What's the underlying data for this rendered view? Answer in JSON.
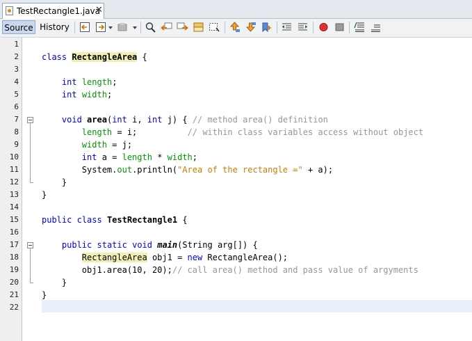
{
  "file_tab": {
    "name": "TestRectangle1.java",
    "close": "✕"
  },
  "editor_tabs": {
    "source": "Source",
    "history": "History"
  },
  "toolbar_icons": [
    "back-icon",
    "forward-icon",
    "last-edit-icon",
    "find-icon",
    "find-previous-icon",
    "find-next-icon",
    "toggle-highlight-icon",
    "find-selection-icon",
    "previous-bookmark-icon",
    "next-bookmark-icon",
    "toggle-bookmark-icon",
    "shift-left-icon",
    "shift-right-icon",
    "start-macro-icon",
    "stop-macro-icon",
    "comment-icon",
    "uncomment-icon"
  ],
  "colors": {
    "keyword": "#0000e6",
    "field": "#009900",
    "string": "#ce7b00",
    "comment": "#969696",
    "highlight": "#f0f0b4",
    "current_line": "#e9eff8"
  },
  "line_numbers": [
    "1",
    "2",
    "3",
    "4",
    "5",
    "6",
    "7",
    "8",
    "9",
    "10",
    "11",
    "12",
    "13",
    "14",
    "15",
    "16",
    "17",
    "18",
    "19",
    "20",
    "21",
    "22"
  ],
  "code": [
    {
      "line": 1,
      "indent": "",
      "tokens": []
    },
    {
      "line": 2,
      "indent": "",
      "tokens": [
        {
          "t": "kw",
          "v": "class"
        },
        {
          "t": "p",
          "v": " "
        },
        {
          "t": "cls-hl",
          "v": "RectangleArea"
        },
        {
          "t": "p",
          "v": " {"
        }
      ]
    },
    {
      "line": 3,
      "indent": "",
      "tokens": []
    },
    {
      "line": 4,
      "indent": "    ",
      "tokens": [
        {
          "t": "kw",
          "v": "int"
        },
        {
          "t": "p",
          "v": " "
        },
        {
          "t": "field",
          "v": "length"
        },
        {
          "t": "p",
          "v": ";"
        }
      ]
    },
    {
      "line": 5,
      "indent": "    ",
      "tokens": [
        {
          "t": "kw",
          "v": "int"
        },
        {
          "t": "p",
          "v": " "
        },
        {
          "t": "field",
          "v": "width"
        },
        {
          "t": "p",
          "v": ";"
        }
      ]
    },
    {
      "line": 6,
      "indent": "",
      "tokens": []
    },
    {
      "line": 7,
      "indent": "    ",
      "tokens": [
        {
          "t": "kw",
          "v": "void"
        },
        {
          "t": "p",
          "v": " "
        },
        {
          "t": "mdef",
          "v": "area"
        },
        {
          "t": "p",
          "v": "("
        },
        {
          "t": "kw",
          "v": "int"
        },
        {
          "t": "p",
          "v": " i, "
        },
        {
          "t": "kw",
          "v": "int"
        },
        {
          "t": "p",
          "v": " j) { "
        },
        {
          "t": "cmt",
          "v": "// method area() definition"
        }
      ]
    },
    {
      "line": 8,
      "indent": "        ",
      "tokens": [
        {
          "t": "field",
          "v": "length"
        },
        {
          "t": "p",
          "v": " = i;          "
        },
        {
          "t": "cmt",
          "v": "// within class variables access without object"
        }
      ]
    },
    {
      "line": 9,
      "indent": "        ",
      "tokens": [
        {
          "t": "field",
          "v": "width"
        },
        {
          "t": "p",
          "v": " = j;"
        }
      ]
    },
    {
      "line": 10,
      "indent": "        ",
      "tokens": [
        {
          "t": "kw",
          "v": "int"
        },
        {
          "t": "p",
          "v": " a = "
        },
        {
          "t": "field",
          "v": "length"
        },
        {
          "t": "p",
          "v": " * "
        },
        {
          "t": "field",
          "v": "width"
        },
        {
          "t": "p",
          "v": ";"
        }
      ]
    },
    {
      "line": 11,
      "indent": "        ",
      "tokens": [
        {
          "t": "p",
          "v": "System."
        },
        {
          "t": "field",
          "v": "out"
        },
        {
          "t": "p",
          "v": ".println("
        },
        {
          "t": "str",
          "v": "\"Area of the rectangle =\""
        },
        {
          "t": "p",
          "v": " + a);"
        }
      ]
    },
    {
      "line": 12,
      "indent": "    ",
      "tokens": [
        {
          "t": "p",
          "v": "}"
        }
      ]
    },
    {
      "line": 13,
      "indent": "",
      "tokens": [
        {
          "t": "p",
          "v": "}"
        }
      ]
    },
    {
      "line": 14,
      "indent": "",
      "tokens": []
    },
    {
      "line": 15,
      "indent": "",
      "tokens": [
        {
          "t": "kw",
          "v": "public"
        },
        {
          "t": "p",
          "v": " "
        },
        {
          "t": "kw",
          "v": "class"
        },
        {
          "t": "p",
          "v": " "
        },
        {
          "t": "cls",
          "v": "TestRectangle1"
        },
        {
          "t": "p",
          "v": " {"
        }
      ]
    },
    {
      "line": 16,
      "indent": "",
      "tokens": []
    },
    {
      "line": 17,
      "indent": "    ",
      "tokens": [
        {
          "t": "kw",
          "v": "public"
        },
        {
          "t": "p",
          "v": " "
        },
        {
          "t": "kw",
          "v": "static"
        },
        {
          "t": "p",
          "v": " "
        },
        {
          "t": "kw",
          "v": "void"
        },
        {
          "t": "p",
          "v": " "
        },
        {
          "t": "static",
          "v": "main"
        },
        {
          "t": "p",
          "v": "(String arg[]) {"
        }
      ]
    },
    {
      "line": 18,
      "indent": "        ",
      "tokens": [
        {
          "t": "hl",
          "v": "RectangleArea"
        },
        {
          "t": "p",
          "v": " obj1 = "
        },
        {
          "t": "kw",
          "v": "new"
        },
        {
          "t": "p",
          "v": " RectangleArea();"
        }
      ]
    },
    {
      "line": 19,
      "indent": "        ",
      "tokens": [
        {
          "t": "p",
          "v": "obj1.area(10, 20);"
        },
        {
          "t": "cmt",
          "v": "// call area() method and pass value of argyments"
        }
      ]
    },
    {
      "line": 20,
      "indent": "    ",
      "tokens": [
        {
          "t": "p",
          "v": "}"
        }
      ]
    },
    {
      "line": 21,
      "indent": "",
      "tokens": [
        {
          "t": "p",
          "v": "}"
        }
      ]
    },
    {
      "line": 22,
      "indent": "",
      "tokens": []
    }
  ]
}
